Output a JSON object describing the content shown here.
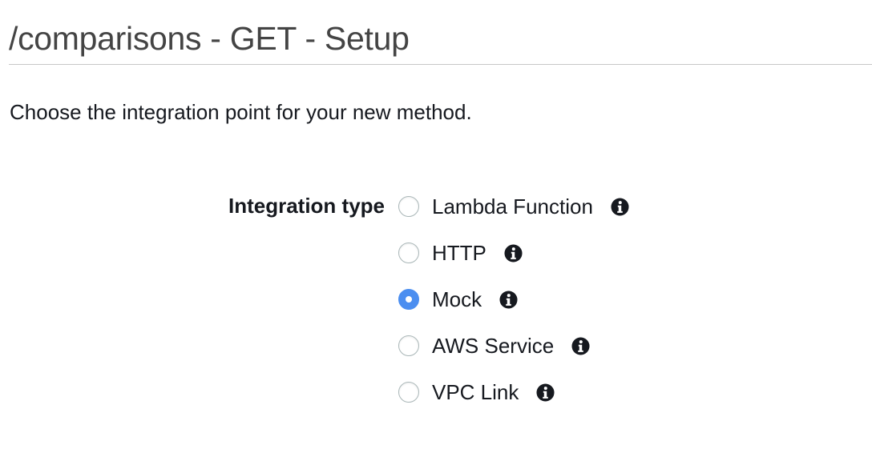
{
  "header": {
    "title": "/comparisons - GET - Setup"
  },
  "intro": {
    "text": "Choose the integration point for your new method."
  },
  "integration": {
    "label": "Integration type",
    "selected": "Mock",
    "options": [
      {
        "label": "Lambda Function",
        "checked": false,
        "icon": "info-icon"
      },
      {
        "label": "HTTP",
        "checked": false,
        "icon": "info-icon"
      },
      {
        "label": "Mock",
        "checked": true,
        "icon": "info-icon"
      },
      {
        "label": "AWS Service",
        "checked": false,
        "icon": "info-icon"
      },
      {
        "label": "VPC Link",
        "checked": false,
        "icon": "info-icon"
      }
    ]
  },
  "colors": {
    "radio_selected": "#4b8ef0",
    "title_text": "#444444",
    "body_text": "#16191f",
    "divider": "#c7c7c7"
  }
}
